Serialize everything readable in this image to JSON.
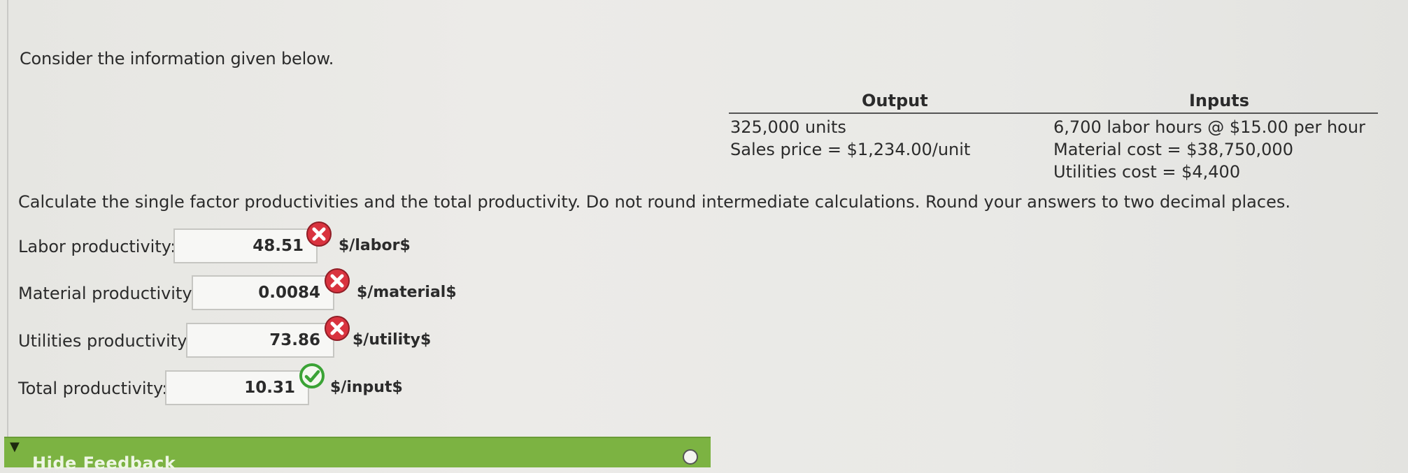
{
  "intro": "Consider the information given below.",
  "table": {
    "output_header": "Output",
    "inputs_header": "Inputs",
    "output_lines": [
      "325,000 units",
      "Sales price = $1,234.00/unit"
    ],
    "input_lines": [
      "6,700 labor hours @ $15.00 per hour",
      "Material cost = $38,750,000",
      "Utilities cost = $4,400"
    ]
  },
  "instructions": "Calculate the single factor productivities and the total productivity. Do not round intermediate calculations. Round your answers to two decimal places.",
  "answers": [
    {
      "label": "Labor productivity:",
      "value": "48.51",
      "unit": "$/labor$",
      "status": "incorrect"
    },
    {
      "label": "Material productivity:",
      "value": "0.0084",
      "unit": "$/material$",
      "status": "incorrect"
    },
    {
      "label": "Utilities productivity:",
      "value": "73.86",
      "unit": "$/utility$",
      "status": "incorrect"
    },
    {
      "label": "Total productivity:",
      "value": "10.31",
      "unit": "$/input$",
      "status": "correct"
    }
  ],
  "feedback": {
    "label": "Hide Feedback"
  },
  "colors": {
    "incorrect": "#d9333f",
    "correct": "#3aa335",
    "feedback_bar": "#7cb342"
  }
}
